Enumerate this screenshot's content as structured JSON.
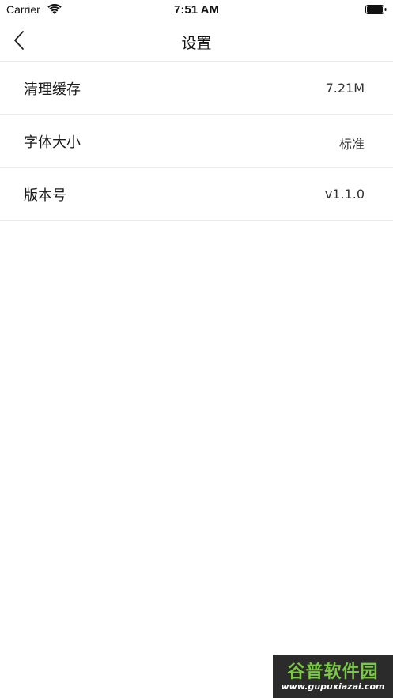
{
  "status_bar": {
    "carrier": "Carrier",
    "time": "7:51 AM"
  },
  "nav": {
    "title": "设置",
    "back_icon": "chevron-left-icon"
  },
  "settings": [
    {
      "label": "清理缓存",
      "value": "7.21M"
    },
    {
      "label": "字体大小",
      "value": "标准"
    },
    {
      "label": "版本号",
      "value": "v1.1.0"
    }
  ],
  "watermark": {
    "name": "谷普软件园",
    "url": "www.gupuxiazai.com"
  },
  "colors": {
    "divider": "#ececec",
    "watermark_green": "#7ac943"
  }
}
